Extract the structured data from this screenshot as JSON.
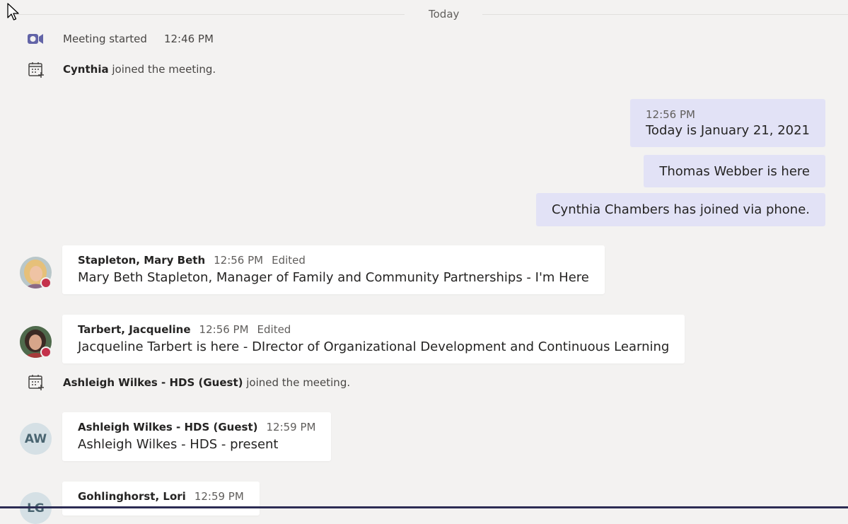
{
  "date_divider": "Today",
  "events": {
    "meeting_started": {
      "label": "Meeting started",
      "time": "12:46 PM"
    },
    "join1": {
      "name": "Cynthia",
      "text": " joined the meeting."
    },
    "join2": {
      "name": "Ashleigh Wilkes - HDS (Guest)",
      "text": " joined the meeting."
    }
  },
  "my_messages": [
    {
      "time": "12:56 PM",
      "text": "Today is January 21, 2021"
    },
    {
      "text": "Thomas Webber is here"
    },
    {
      "text": "Cynthia Chambers has joined via phone."
    }
  ],
  "messages": [
    {
      "author": "Stapleton, Mary Beth",
      "time": "12:56 PM",
      "edited": "Edited",
      "text": "Mary Beth Stapleton, Manager of Family and Community Partnerships - I'm Here"
    },
    {
      "author": "Tarbert, Jacqueline",
      "time": "12:56 PM",
      "edited": "Edited",
      "text": "Jacqueline Tarbert is here - DIrector of Organizational Development and Continuous Learning"
    },
    {
      "author": "Ashleigh Wilkes - HDS (Guest)",
      "time": "12:59 PM",
      "initials": "AW",
      "text": "Ashleigh Wilkes - HDS - present"
    },
    {
      "author": "Gohlinghorst, Lori",
      "time": "12:59 PM",
      "initials": "LG"
    }
  ],
  "colors": {
    "background": "#f3f2f1",
    "my_bubble": "#e2e2f6",
    "presence_busy": "#c4314b",
    "brand": "#6264a7"
  },
  "icons": [
    "cursor-arrow-icon",
    "meeting-camera-icon",
    "calendar-join-icon"
  ]
}
